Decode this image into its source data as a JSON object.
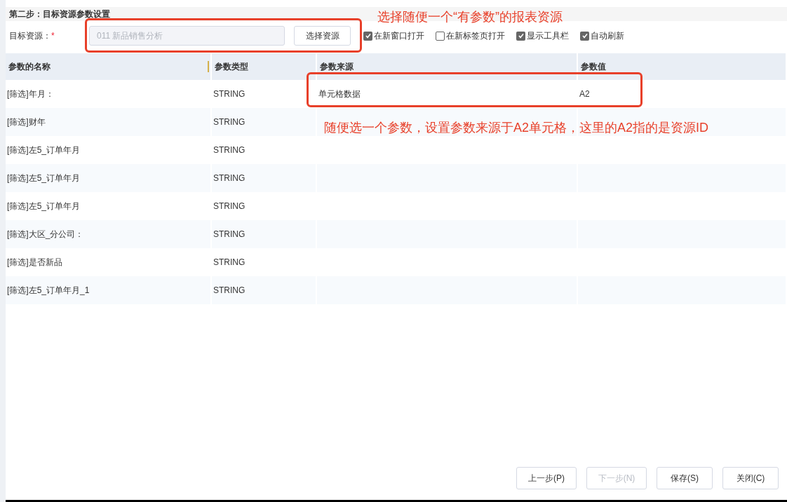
{
  "section_title": "第二步：目标资源参数设置",
  "target": {
    "label": "目标资源：",
    "required_mark": "*",
    "value": "011 新品销售分析",
    "button": "选择资源"
  },
  "options": [
    {
      "label": "在新窗口打开",
      "checked": true
    },
    {
      "label": "在新标签页打开",
      "checked": false
    },
    {
      "label": "显示工具栏",
      "checked": true
    },
    {
      "label": "自动刷新",
      "checked": true
    }
  ],
  "table": {
    "columns": [
      "参数的名称",
      "参数类型",
      "参数来源",
      "参数值"
    ],
    "rows": [
      {
        "name": "[筛选]年月：",
        "type": "STRING",
        "source": "单元格数据",
        "value": "A2"
      },
      {
        "name": "[筛选]财年",
        "type": "STRING"
      },
      {
        "name": "[筛选]左5_订单年月",
        "type": "STRING"
      },
      {
        "name": "[筛选]左5_订单年月",
        "type": "STRING"
      },
      {
        "name": "[筛选]左5_订单年月",
        "type": "STRING"
      },
      {
        "name": "[筛选]大区_分公司：",
        "type": "STRING"
      },
      {
        "name": "[筛选]是否新品",
        "type": "STRING"
      },
      {
        "name": "[筛选]左5_订单年月_1",
        "type": "STRING"
      }
    ]
  },
  "buttons": [
    {
      "label": "上一步(P)",
      "disabled": false
    },
    {
      "label": "下一步(N)",
      "disabled": true
    },
    {
      "label": "保存(S)",
      "disabled": false
    },
    {
      "label": "关闭(C)",
      "disabled": false
    }
  ],
  "annotations": [
    "选择随便一个“有参数”的报表资源",
    "随便选一个参数，设置参数来源于A2单元格，这里的A2指的是资源ID"
  ]
}
